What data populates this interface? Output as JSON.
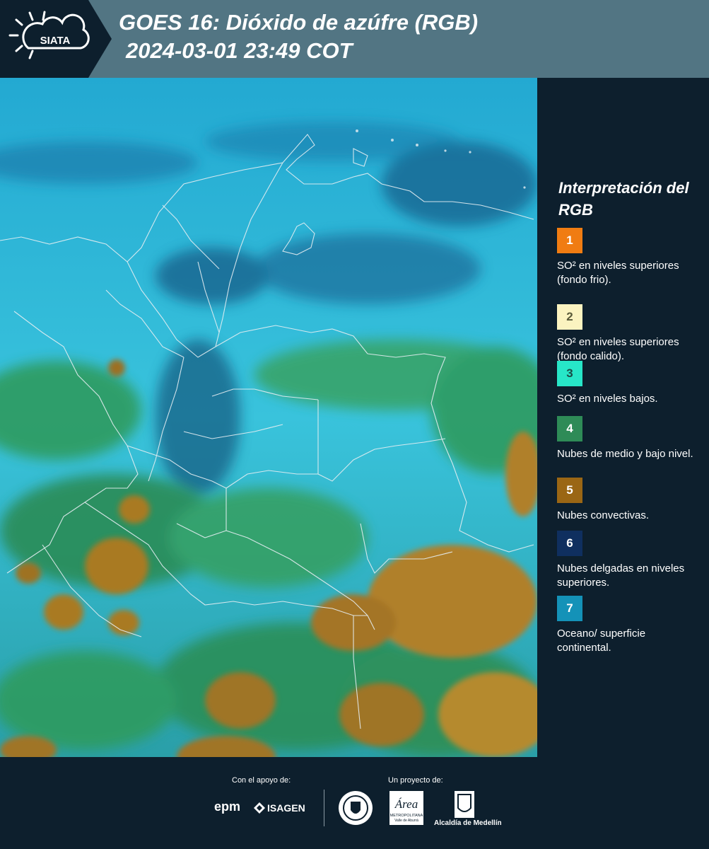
{
  "header": {
    "logo_text": "SIATA",
    "title_line1": "GOES 16: Dióxido de azúfre (RGB)",
    "title_line2": "2024-03-01 23:49 COT"
  },
  "legend": {
    "title": "Interpretación del RGB",
    "items": [
      {
        "number": "1",
        "text": "SO² en niveles superiores (fondo frio).",
        "color": "#f07c12",
        "number_color": "#ffffff"
      },
      {
        "number": "2",
        "text": "SO² en niveles superiores (fondo calido).",
        "color": "#fbf3c0",
        "number_color": "#5a5a3a"
      },
      {
        "number": "3",
        "text": "SO² en niveles bajos.",
        "color": "#27e6c8",
        "number_color": "#1a4a45"
      },
      {
        "number": "4",
        "text": "Nubes de medio y bajo nivel.",
        "color": "#2e8b57",
        "number_color": "#ffffff"
      },
      {
        "number": "5",
        "text": "Nubes convectivas.",
        "color": "#9a6614",
        "number_color": "#ffffff"
      },
      {
        "number": "6",
        "text": "Nubes delgadas en niveles superiores.",
        "color": "#0f2f5f",
        "number_color": "#ffffff"
      },
      {
        "number": "7",
        "text": "Oceano/ superficie continental.",
        "color": "#1492b8",
        "number_color": "#ffffff"
      }
    ]
  },
  "footer": {
    "support_label": "Con el apoyo de:",
    "project_label": "Un proyecto de:",
    "epm": "epm",
    "isagen": "ISAGEN",
    "area_name": "Área",
    "area_sub1": "METROPOLITANA",
    "area_sub2": "Valle de Aburrá",
    "alcaldia": "Alcaldía de Medellín"
  },
  "colors": {
    "header_bg": "#527583",
    "dark_bg": "#0d1f2d",
    "sky_cyan": "#29b9dc",
    "cloud_green": "#2e9b5f",
    "convective_brown": "#a97a22"
  }
}
